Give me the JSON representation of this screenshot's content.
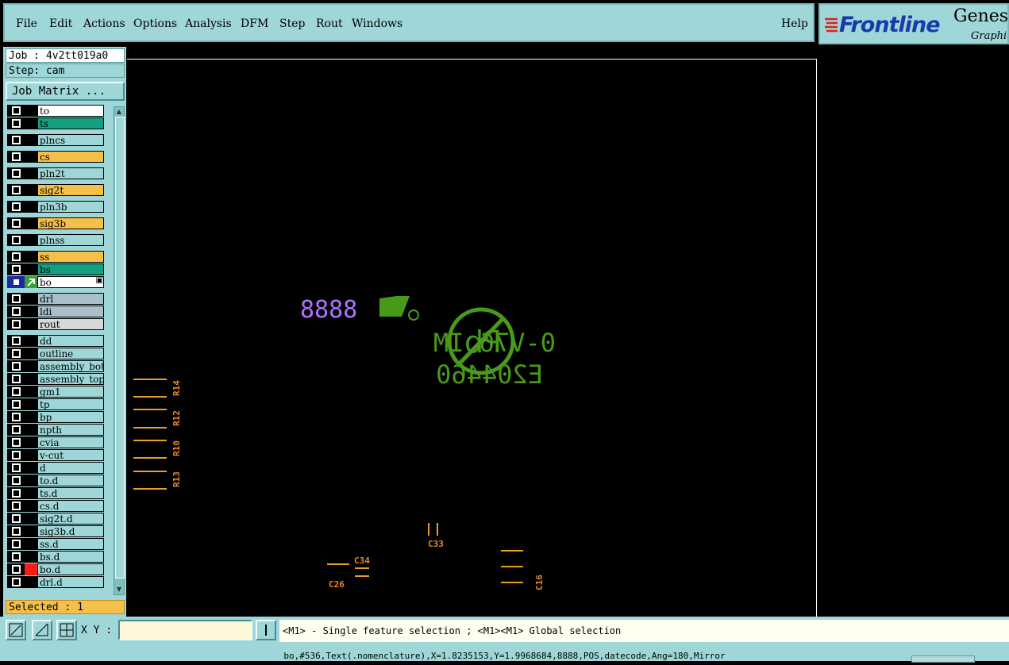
{
  "menu": {
    "items": [
      {
        "label": "File",
        "ul": true
      },
      {
        "label": "Edit",
        "ul": true
      },
      {
        "label": "Actions",
        "ul": true
      },
      {
        "label": "Options",
        "ul": true
      },
      {
        "label": "Analysis",
        "ul": false
      },
      {
        "label": "DFM",
        "ul": false
      },
      {
        "label": "Step",
        "ul": true
      },
      {
        "label": "Rout",
        "ul": true
      },
      {
        "label": "Windows",
        "ul": true
      }
    ],
    "help": "Help"
  },
  "logo": {
    "brand": "Frontline",
    "app": "Genesis",
    "sub": "Graphic"
  },
  "left": {
    "job": "Job : 4v2tt019a0",
    "step": "Step: cam",
    "job_matrix": "Job Matrix ...",
    "selected": "Selected : 1"
  },
  "layers": [
    {
      "name": "to",
      "color": "#ffffff"
    },
    {
      "name": "ts",
      "color": "#159e80"
    },
    {
      "name": "plncs",
      "color": "#9fd7d9"
    },
    {
      "name": "cs",
      "color": "#f5c04a"
    },
    {
      "name": "pln2t",
      "color": "#9fd7d9"
    },
    {
      "name": "sig2t",
      "color": "#f5c04a"
    },
    {
      "name": "pln3b",
      "color": "#9fd7d9"
    },
    {
      "name": "sig3b",
      "color": "#f5c04a"
    },
    {
      "name": "plnss",
      "color": "#9fd7d9"
    },
    {
      "name": "ss",
      "color": "#f5c04a"
    },
    {
      "name": "bs",
      "color": "#159e80"
    },
    {
      "name": "bo",
      "color": "#ffffff",
      "active": true
    },
    {
      "name": "drl",
      "color": "#a9c0c8"
    },
    {
      "name": "ldi",
      "color": "#a9c0c8"
    },
    {
      "name": "rout",
      "color": "#d8d8d8"
    },
    {
      "name": "dd",
      "color": "#9fd7d9"
    },
    {
      "name": "outline",
      "color": "#9fd7d9"
    },
    {
      "name": "assembly_bot",
      "color": "#9fd7d9"
    },
    {
      "name": "assembly_top",
      "color": "#9fd7d9"
    },
    {
      "name": "gm1",
      "color": "#9fd7d9"
    },
    {
      "name": "tp",
      "color": "#9fd7d9"
    },
    {
      "name": "bp",
      "color": "#9fd7d9"
    },
    {
      "name": "npth",
      "color": "#9fd7d9"
    },
    {
      "name": "cvia",
      "color": "#9fd7d9"
    },
    {
      "name": "v-cut",
      "color": "#9fd7d9"
    },
    {
      "name": "d",
      "color": "#9fd7d9"
    },
    {
      "name": "to.d",
      "color": "#9fd7d9"
    },
    {
      "name": "ts.d",
      "color": "#9fd7d9"
    },
    {
      "name": "cs.d",
      "color": "#9fd7d9"
    },
    {
      "name": "sig2t.d",
      "color": "#9fd7d9"
    },
    {
      "name": "sig3b.d",
      "color": "#9fd7d9"
    },
    {
      "name": "ss.d",
      "color": "#9fd7d9"
    },
    {
      "name": "bs.d",
      "color": "#9fd7d9"
    },
    {
      "name": "bo.d",
      "color": "#9fd7d9",
      "mark": "#ff1a1a"
    },
    {
      "name": "drl.d",
      "color": "#9fd7d9"
    }
  ],
  "canvas": {
    "date_code": "8888",
    "part_line1": "0-V76 IM",
    "part_line2": "E204460",
    "ul_mark": "UL",
    "pb_mark": "Pb",
    "refdes": [
      "R14",
      "R12",
      "R10",
      "R13",
      "C34",
      "C33",
      "C26",
      "C16"
    ],
    "colors": {
      "silk": "#4a9a1a",
      "date": "#b070ff",
      "pads": "#e8a020",
      "refdes": "#e88a20"
    }
  },
  "bottom": {
    "xy_label": "X Y :",
    "xy_value": "",
    "hint": "<M1> - Single feature selection ; <M1><M1> Global selection",
    "status": "bo,#536,Text(.nomenclature),X=1.8235153,Y=1.9968684,8888,POS,datecode,Ang=180,Mirror"
  }
}
